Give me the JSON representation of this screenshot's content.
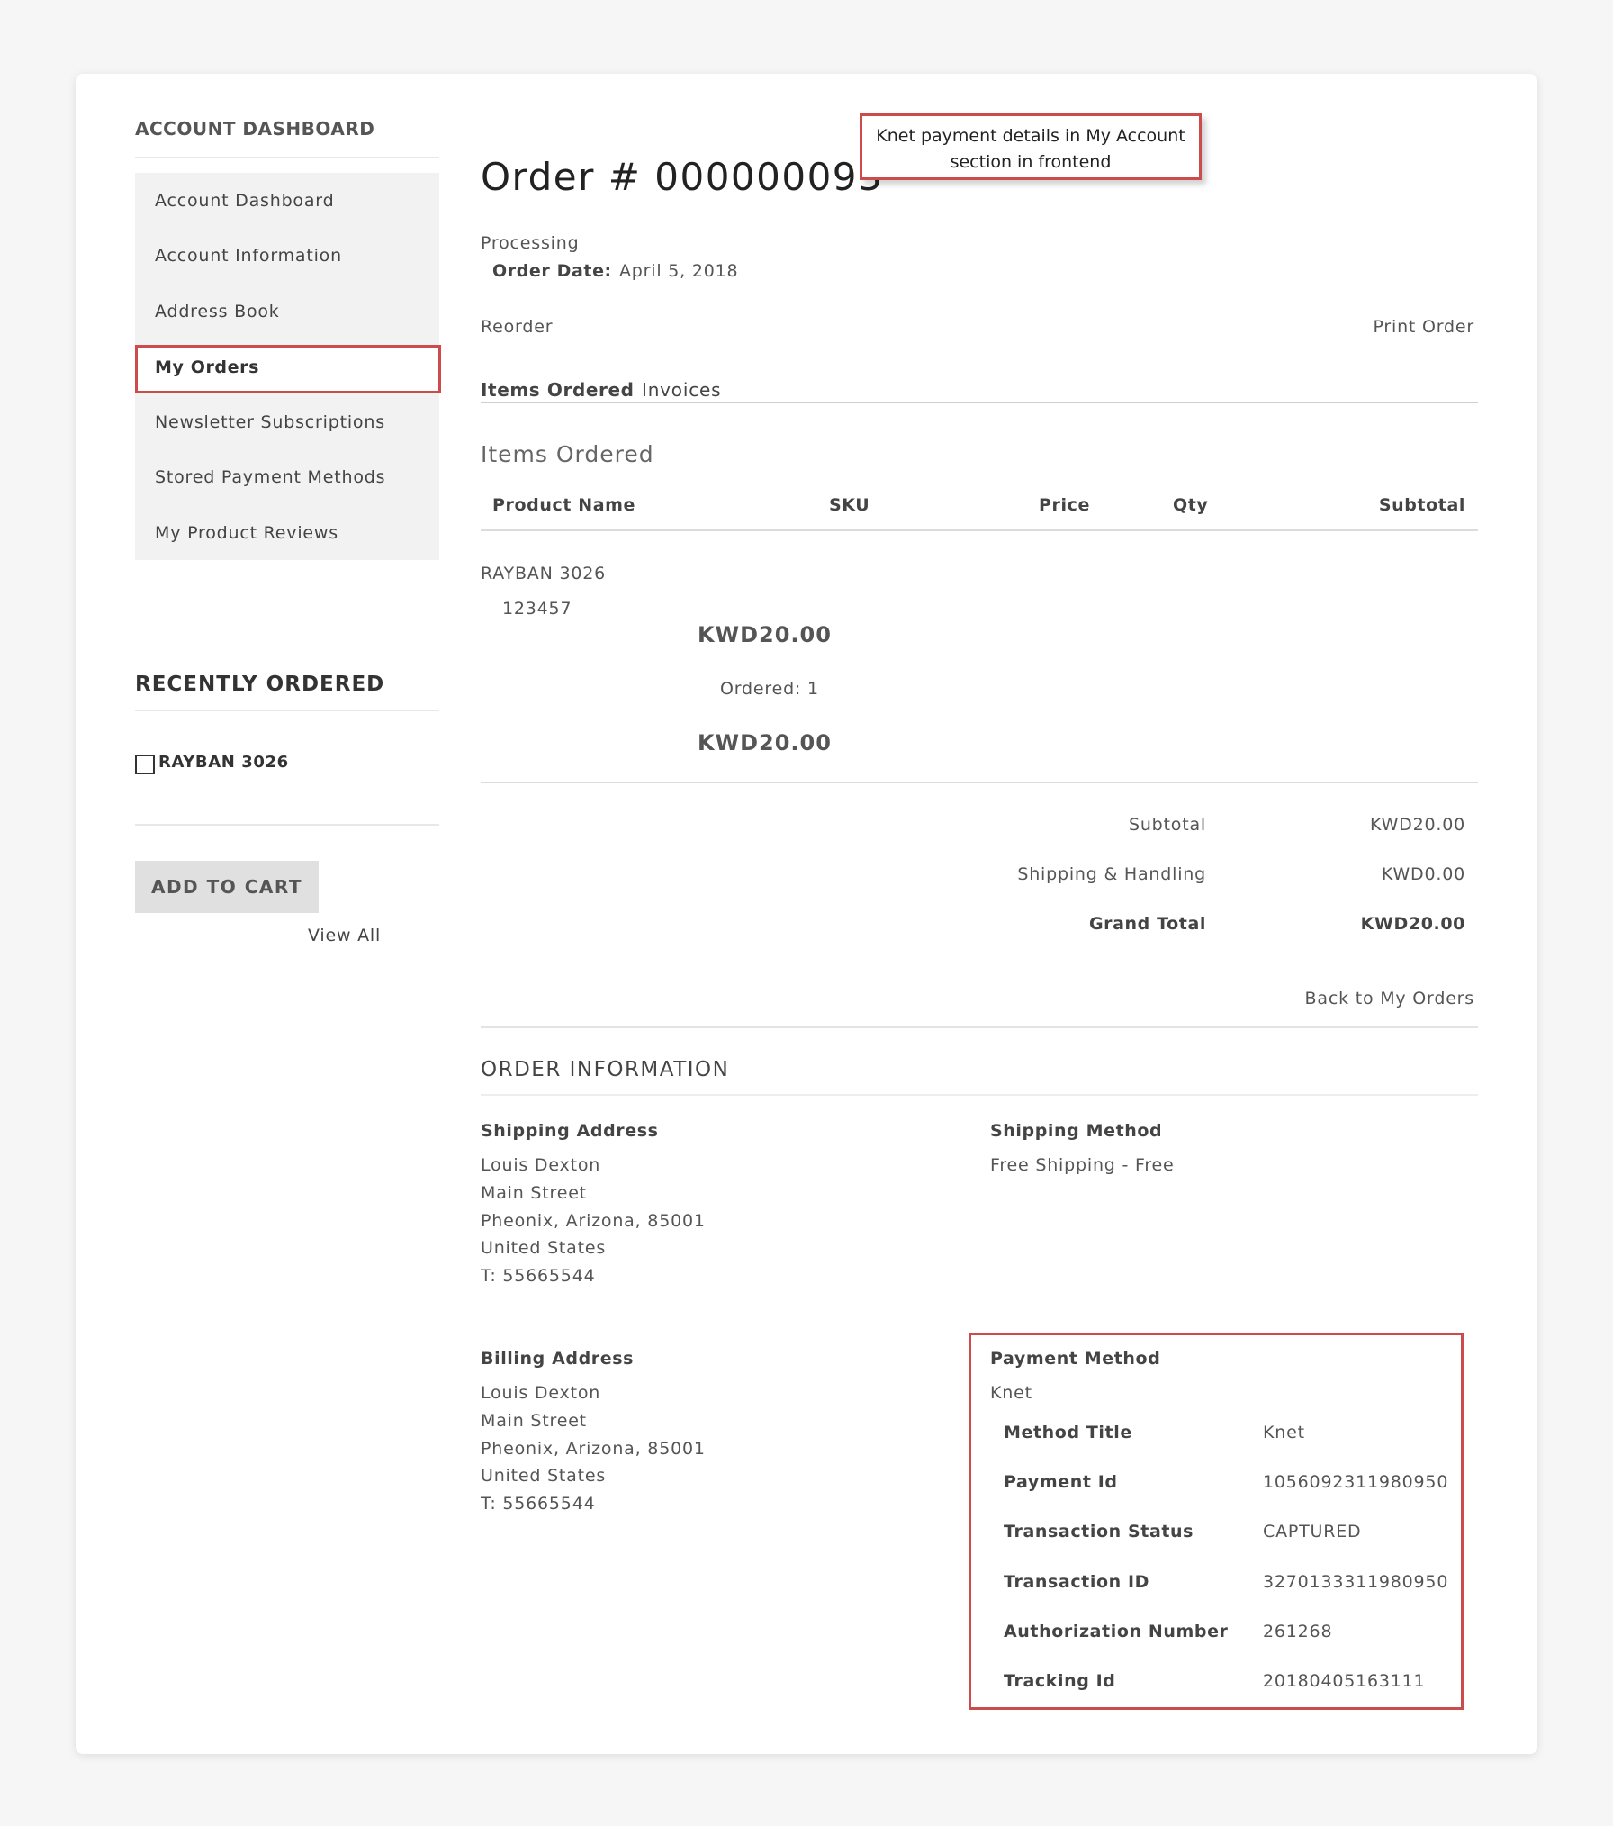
{
  "sidebar": {
    "title": "ACCOUNT DASHBOARD",
    "items": [
      {
        "label": "Account Dashboard"
      },
      {
        "label": "Account Information"
      },
      {
        "label": "Address Book"
      },
      {
        "label": "My Orders"
      },
      {
        "label": "Newsletter Subscriptions"
      },
      {
        "label": "Stored Payment Methods"
      },
      {
        "label": "My Product Reviews"
      }
    ],
    "recent": {
      "title": "RECENTLY ORDERED",
      "item": "RAYBAN 3026",
      "add_to_cart": "ADD TO CART",
      "view_all": "View All"
    }
  },
  "callout": {
    "line1": "Knet payment details in My Account",
    "line2": "section in frontend"
  },
  "order": {
    "title": "Order # 000000093",
    "status": "Processing",
    "date_label": "Order Date:",
    "date_value": "April 5, 2018",
    "reorder": "Reorder",
    "print": "Print Order",
    "tabs": [
      {
        "label": "Items Ordered"
      },
      {
        "label": "Invoices"
      }
    ],
    "section_title": "Items Ordered",
    "table": {
      "headers": {
        "name": "Product Name",
        "sku": "SKU",
        "price": "Price",
        "qty": "Qty",
        "subtotal": "Subtotal"
      },
      "row": {
        "name": "RAYBAN 3026",
        "sku": "123457",
        "price": "KWD20.00",
        "qty": "Ordered: 1",
        "subtotal": "KWD20.00"
      }
    },
    "totals": [
      {
        "label": "Subtotal",
        "value": "KWD20.00"
      },
      {
        "label": "Shipping & Handling",
        "value": "KWD0.00"
      },
      {
        "label": "Grand Total",
        "value": "KWD20.00"
      }
    ],
    "back": "Back to My Orders"
  },
  "info": {
    "title": "ORDER INFORMATION",
    "shipping_address": {
      "title": "Shipping Address",
      "lines": [
        "Louis Dexton",
        "Main Street",
        "Pheonix, Arizona, 85001",
        "United States",
        "T: 55665544"
      ]
    },
    "shipping_method": {
      "title": "Shipping Method",
      "value": "Free Shipping - Free"
    },
    "billing_address": {
      "title": "Billing Address",
      "lines": [
        "Louis Dexton",
        "Main Street",
        "Pheonix, Arizona, 85001",
        "United States",
        "T: 55665544"
      ]
    },
    "payment": {
      "title": "Payment Method",
      "name": "Knet",
      "rows": [
        {
          "label": "Method Title",
          "value": "Knet"
        },
        {
          "label": "Payment Id",
          "value": "1056092311980950"
        },
        {
          "label": "Transaction Status",
          "value": "CAPTURED"
        },
        {
          "label": "Transaction ID",
          "value": "3270133311980950"
        },
        {
          "label": "Authorization Number",
          "value": "261268"
        },
        {
          "label": "Tracking Id",
          "value": "20180405163111"
        }
      ]
    }
  },
  "colors": {
    "highlight": "#cc4b4b",
    "sidebar_bg": "#f2f2f2",
    "button_bg": "#e0e0e0"
  }
}
